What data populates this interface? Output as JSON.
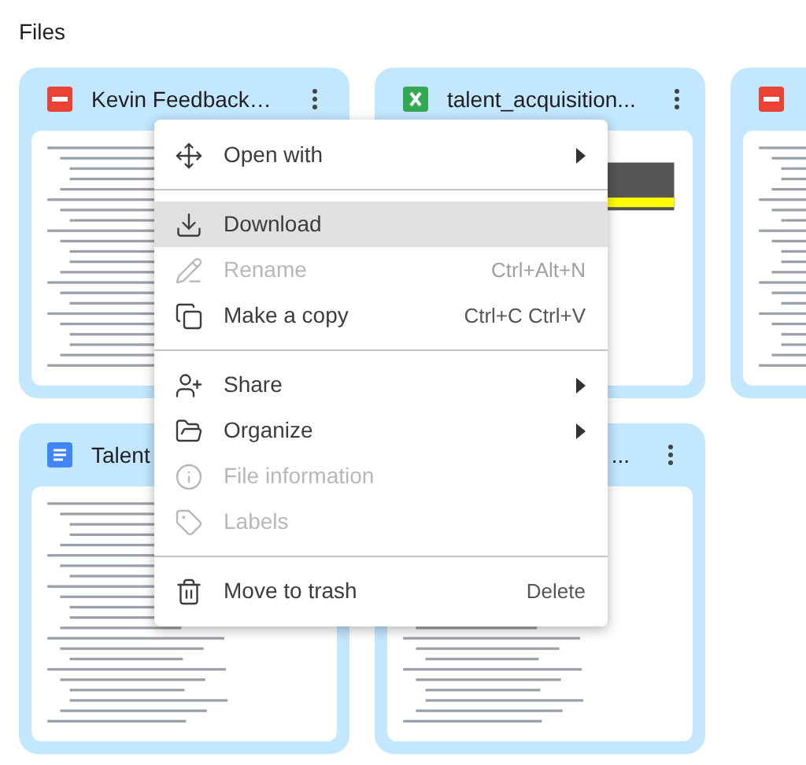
{
  "heading": "Files",
  "files": [
    {
      "kind": "pdf",
      "title": "Kevin Feedback…"
    },
    {
      "kind": "sheet",
      "title": "talent_acquisition..."
    },
    {
      "kind": "pdf"
    },
    {
      "kind": "doc",
      "title": "Talent"
    },
    {
      "title": "..."
    }
  ],
  "menu": [
    {
      "kind": "item",
      "label": "Open with",
      "submenu": true,
      "disabled": false,
      "selected": false
    },
    {
      "kind": "divider"
    },
    {
      "kind": "item",
      "label": "Download",
      "submenu": false,
      "disabled": false,
      "selected": true
    },
    {
      "kind": "item",
      "label": "Rename",
      "shortcut": "Ctrl+Alt+N",
      "submenu": false,
      "disabled": true,
      "selected": false
    },
    {
      "kind": "item",
      "label": "Make a copy",
      "shortcut": "Ctrl+C Ctrl+V",
      "submenu": false,
      "disabled": false,
      "selected": false
    },
    {
      "kind": "divider"
    },
    {
      "kind": "item",
      "label": "Share",
      "submenu": true,
      "disabled": false,
      "selected": false
    },
    {
      "kind": "item",
      "label": "Organize",
      "submenu": true,
      "disabled": false,
      "selected": false
    },
    {
      "kind": "item",
      "label": "File information",
      "submenu": false,
      "disabled": true,
      "selected": false
    },
    {
      "kind": "item",
      "label": "Labels",
      "submenu": false,
      "disabled": true,
      "selected": false
    },
    {
      "kind": "divider"
    },
    {
      "kind": "item",
      "label": "Move to trash",
      "shortcut": "Delete",
      "submenu": false,
      "disabled": false,
      "selected": false
    }
  ]
}
